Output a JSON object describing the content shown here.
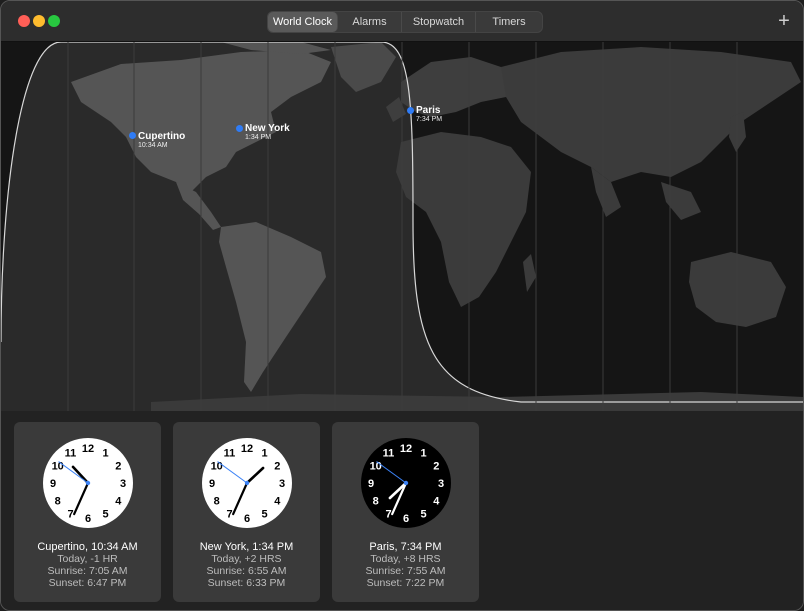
{
  "window": {
    "tabs": [
      {
        "label": "World Clock",
        "active": true
      },
      {
        "label": "Alarms",
        "active": false
      },
      {
        "label": "Stopwatch",
        "active": false
      },
      {
        "label": "Timers",
        "active": false
      }
    ],
    "add_label": "+"
  },
  "map": {
    "cities": [
      {
        "name": "Cupertino",
        "time": "10:34 AM"
      },
      {
        "name": "New York",
        "time": "1:34 PM"
      },
      {
        "name": "Paris",
        "time": "7:34 PM"
      }
    ]
  },
  "clocks": [
    {
      "title": "Cupertino, 10:34 AM",
      "offset": "Today, -1 HR",
      "sunrise": "Sunrise: 7:05 AM",
      "sunset": "Sunset: 6:47 PM",
      "face": "light",
      "hour": 10,
      "minute": 34
    },
    {
      "title": "New York, 1:34 PM",
      "offset": "Today, +2 HRS",
      "sunrise": "Sunrise: 6:55 AM",
      "sunset": "Sunset: 6:33 PM",
      "face": "light",
      "hour": 1,
      "minute": 34
    },
    {
      "title": "Paris, 7:34 PM",
      "offset": "Today, +8 HRS",
      "sunrise": "Sunrise: 7:55 AM",
      "sunset": "Sunset: 7:22 PM",
      "face": "dark",
      "hour": 7,
      "minute": 34
    }
  ],
  "clock_numerals": [
    "12",
    "1",
    "2",
    "3",
    "4",
    "5",
    "6",
    "7",
    "8",
    "9",
    "10",
    "11"
  ],
  "colors": {
    "accent": "#2f7cf6",
    "second_hand": "#3b82f6",
    "day_region": "#2a2a2a",
    "night_region": "#151515",
    "land_day": "#525252",
    "land_night": "#3a3a3a"
  }
}
